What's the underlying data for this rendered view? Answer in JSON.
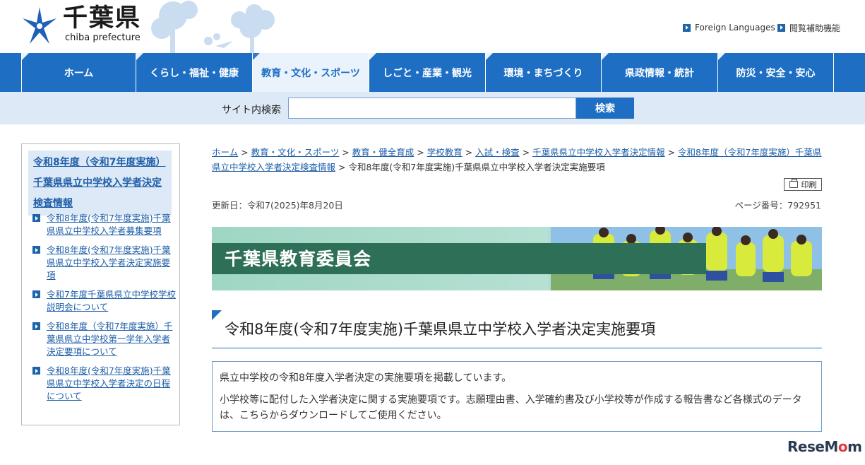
{
  "header": {
    "logo_title": "千葉県",
    "logo_sub": "chiba prefecture",
    "utility_links": [
      {
        "label": "Foreign Languages"
      },
      {
        "label": "閲覧補助機能"
      }
    ]
  },
  "nav": {
    "items": [
      {
        "label": "ホーム"
      },
      {
        "label": "くらし・福祉・健康"
      },
      {
        "label": "教育・文化・スポーツ"
      },
      {
        "label": "しごと・産業・観光"
      },
      {
        "label": "環境・まちづくり"
      },
      {
        "label": "県政情報・統計"
      },
      {
        "label": "防災・安全・安心"
      }
    ],
    "active_index": 2
  },
  "search": {
    "label": "サイト内検索",
    "value": "",
    "placeholder": "",
    "button_label": "検索"
  },
  "sidebar": {
    "heading": "令和8年度（令和7年度実施）千葉県県立中学校入学者決定検査情報",
    "items": [
      {
        "label": "令和8年度(令和7年度実施)千葉県県立中学校入学者募集要項"
      },
      {
        "label": "令和8年度(令和7年度実施)千葉県県立中学校入学者決定実施要項"
      },
      {
        "label": "令和7年度千葉県県立中学校学校説明会について"
      },
      {
        "label": "令和8年度（令和7年度実施）千葉県県立中学校第一学年入学者決定要項について"
      },
      {
        "label": "令和8年度(令和7年度実施)千葉県県立中学校入学者決定の日程について"
      }
    ]
  },
  "breadcrumb": {
    "links": [
      {
        "label": "ホーム"
      },
      {
        "label": "教育・文化・スポーツ"
      },
      {
        "label": "教育・健全育成"
      },
      {
        "label": "学校教育"
      },
      {
        "label": "入試・検査"
      },
      {
        "label": "千葉県県立中学校入学者決定情報"
      },
      {
        "label": "令和8年度（令和7年度実施）千葉県県立中学校入学者決定検査情報"
      }
    ],
    "separator": " > ",
    "current": "令和8年度(令和7年度実施)千葉県県立中学校入学者決定実施要項"
  },
  "page": {
    "print_label": "印刷",
    "updated": "更新日：令和7(2025)年8月20日",
    "page_number": "ページ番号：792951",
    "banner_text": "千葉県教育委員会",
    "title": "令和8年度(令和7年度実施)千葉県県立中学校入学者決定実施要項",
    "paragraphs": [
      "県立中学校の令和8年度入学者決定の実施要項を掲載しています。",
      "小学校等に配付した入学者決定に関する実施要項です。志願理由書、入学確約書及び小学校等が作成する報告書など各様式のデータは、こちらからダウンロードしてご使用ください。"
    ]
  },
  "colors": {
    "nav_blue": "#1e6fc4",
    "link_blue": "#1e5fa8",
    "banner_green": "#2d6f57",
    "search_bg": "#dde9f6"
  },
  "watermark": {
    "pre": "ReseM",
    "o": "o",
    "post": "m"
  }
}
